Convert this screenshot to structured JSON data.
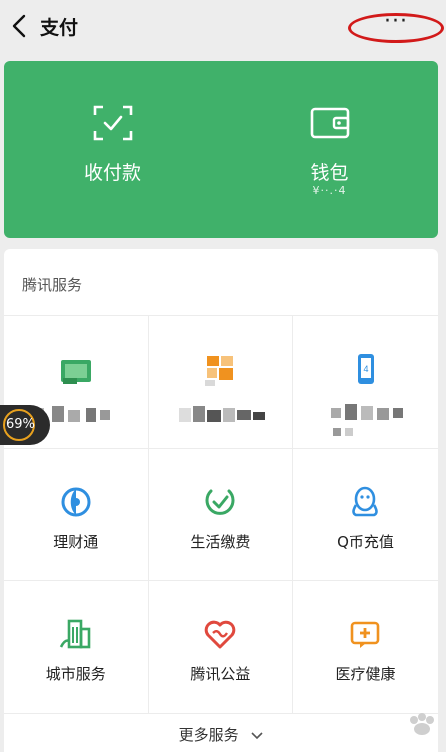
{
  "header": {
    "title": "支付",
    "more_label": "···"
  },
  "wallet_card": {
    "receive_pay": {
      "label": "收付款",
      "icon": "scan-check-icon"
    },
    "wallet": {
      "label": "钱包",
      "balance_masked": "¥··.·4",
      "icon": "wallet-icon"
    }
  },
  "services": {
    "section_title": "腾讯服务",
    "items": [
      {
        "label": "",
        "icon": "credit-card-icon",
        "blurred": true
      },
      {
        "label": "",
        "icon": "grid-app-icon",
        "blurred": true
      },
      {
        "label": "",
        "icon": "phone-topup-icon",
        "blurred": true
      },
      {
        "label": "理财通",
        "icon": "finance-circle-icon"
      },
      {
        "label": "生活缴费",
        "icon": "utility-bill-icon"
      },
      {
        "label": "Q币充值",
        "icon": "penguin-icon"
      },
      {
        "label": "城市服务",
        "icon": "city-building-icon"
      },
      {
        "label": "腾讯公益",
        "icon": "charity-heart-icon"
      },
      {
        "label": "医疗健康",
        "icon": "medical-cross-icon"
      }
    ],
    "more_label": "更多服务"
  },
  "overlay": {
    "battery_percent": "69%"
  },
  "colors": {
    "green": "#40b16a",
    "red_annotation": "#d21a1a",
    "icon_green": "#3aa864",
    "icon_blue": "#2f8fe0",
    "icon_red": "#e0493e",
    "icon_orange": "#f0921f"
  }
}
